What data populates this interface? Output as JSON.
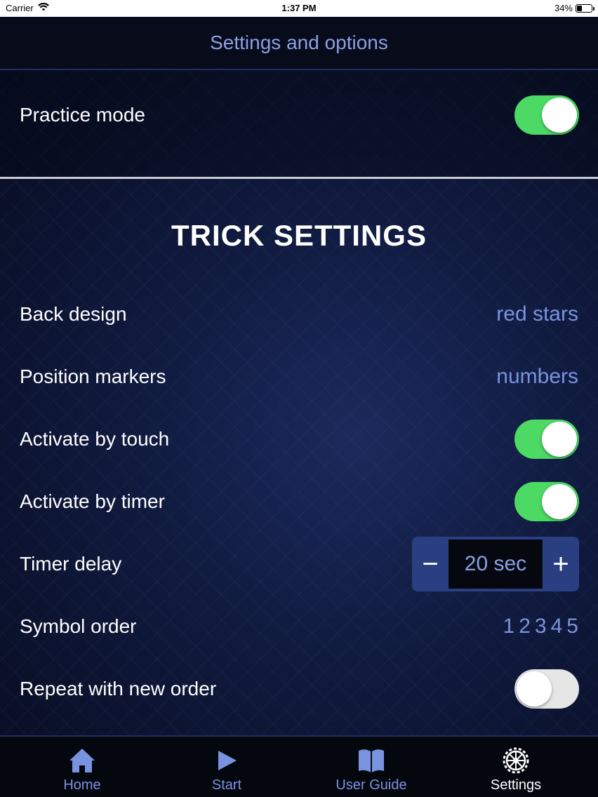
{
  "status": {
    "carrier": "Carrier",
    "time": "1:37 PM",
    "battery_percent": "34%",
    "battery_level": 0.34
  },
  "nav": {
    "title": "Settings and options"
  },
  "practice": {
    "label": "Practice mode",
    "on": true
  },
  "section_title": "TRICK SETTINGS",
  "rows": {
    "back_design": {
      "label": "Back design",
      "value": "red stars"
    },
    "position_markers": {
      "label": "Position markers",
      "value": "numbers"
    },
    "activate_touch": {
      "label": "Activate by touch",
      "on": true
    },
    "activate_timer": {
      "label": "Activate by timer",
      "on": true
    },
    "timer_delay": {
      "label": "Timer delay",
      "value": "20 sec",
      "minus": "−",
      "plus": "+"
    },
    "symbol_order": {
      "label": "Symbol order",
      "value": "12345"
    },
    "repeat_order": {
      "label": "Repeat with new order",
      "on": false
    }
  },
  "tabs": [
    {
      "label": "Home",
      "icon": "home-icon"
    },
    {
      "label": "Start",
      "icon": "play-icon"
    },
    {
      "label": "User Guide",
      "icon": "book-icon"
    },
    {
      "label": "Settings",
      "icon": "gear-icon",
      "active": true
    }
  ],
  "colors": {
    "accent": "#7a93e0",
    "toggle_on": "#4cd964",
    "toggle_off": "#e6e6e6",
    "stepper": "#2a3f82"
  }
}
